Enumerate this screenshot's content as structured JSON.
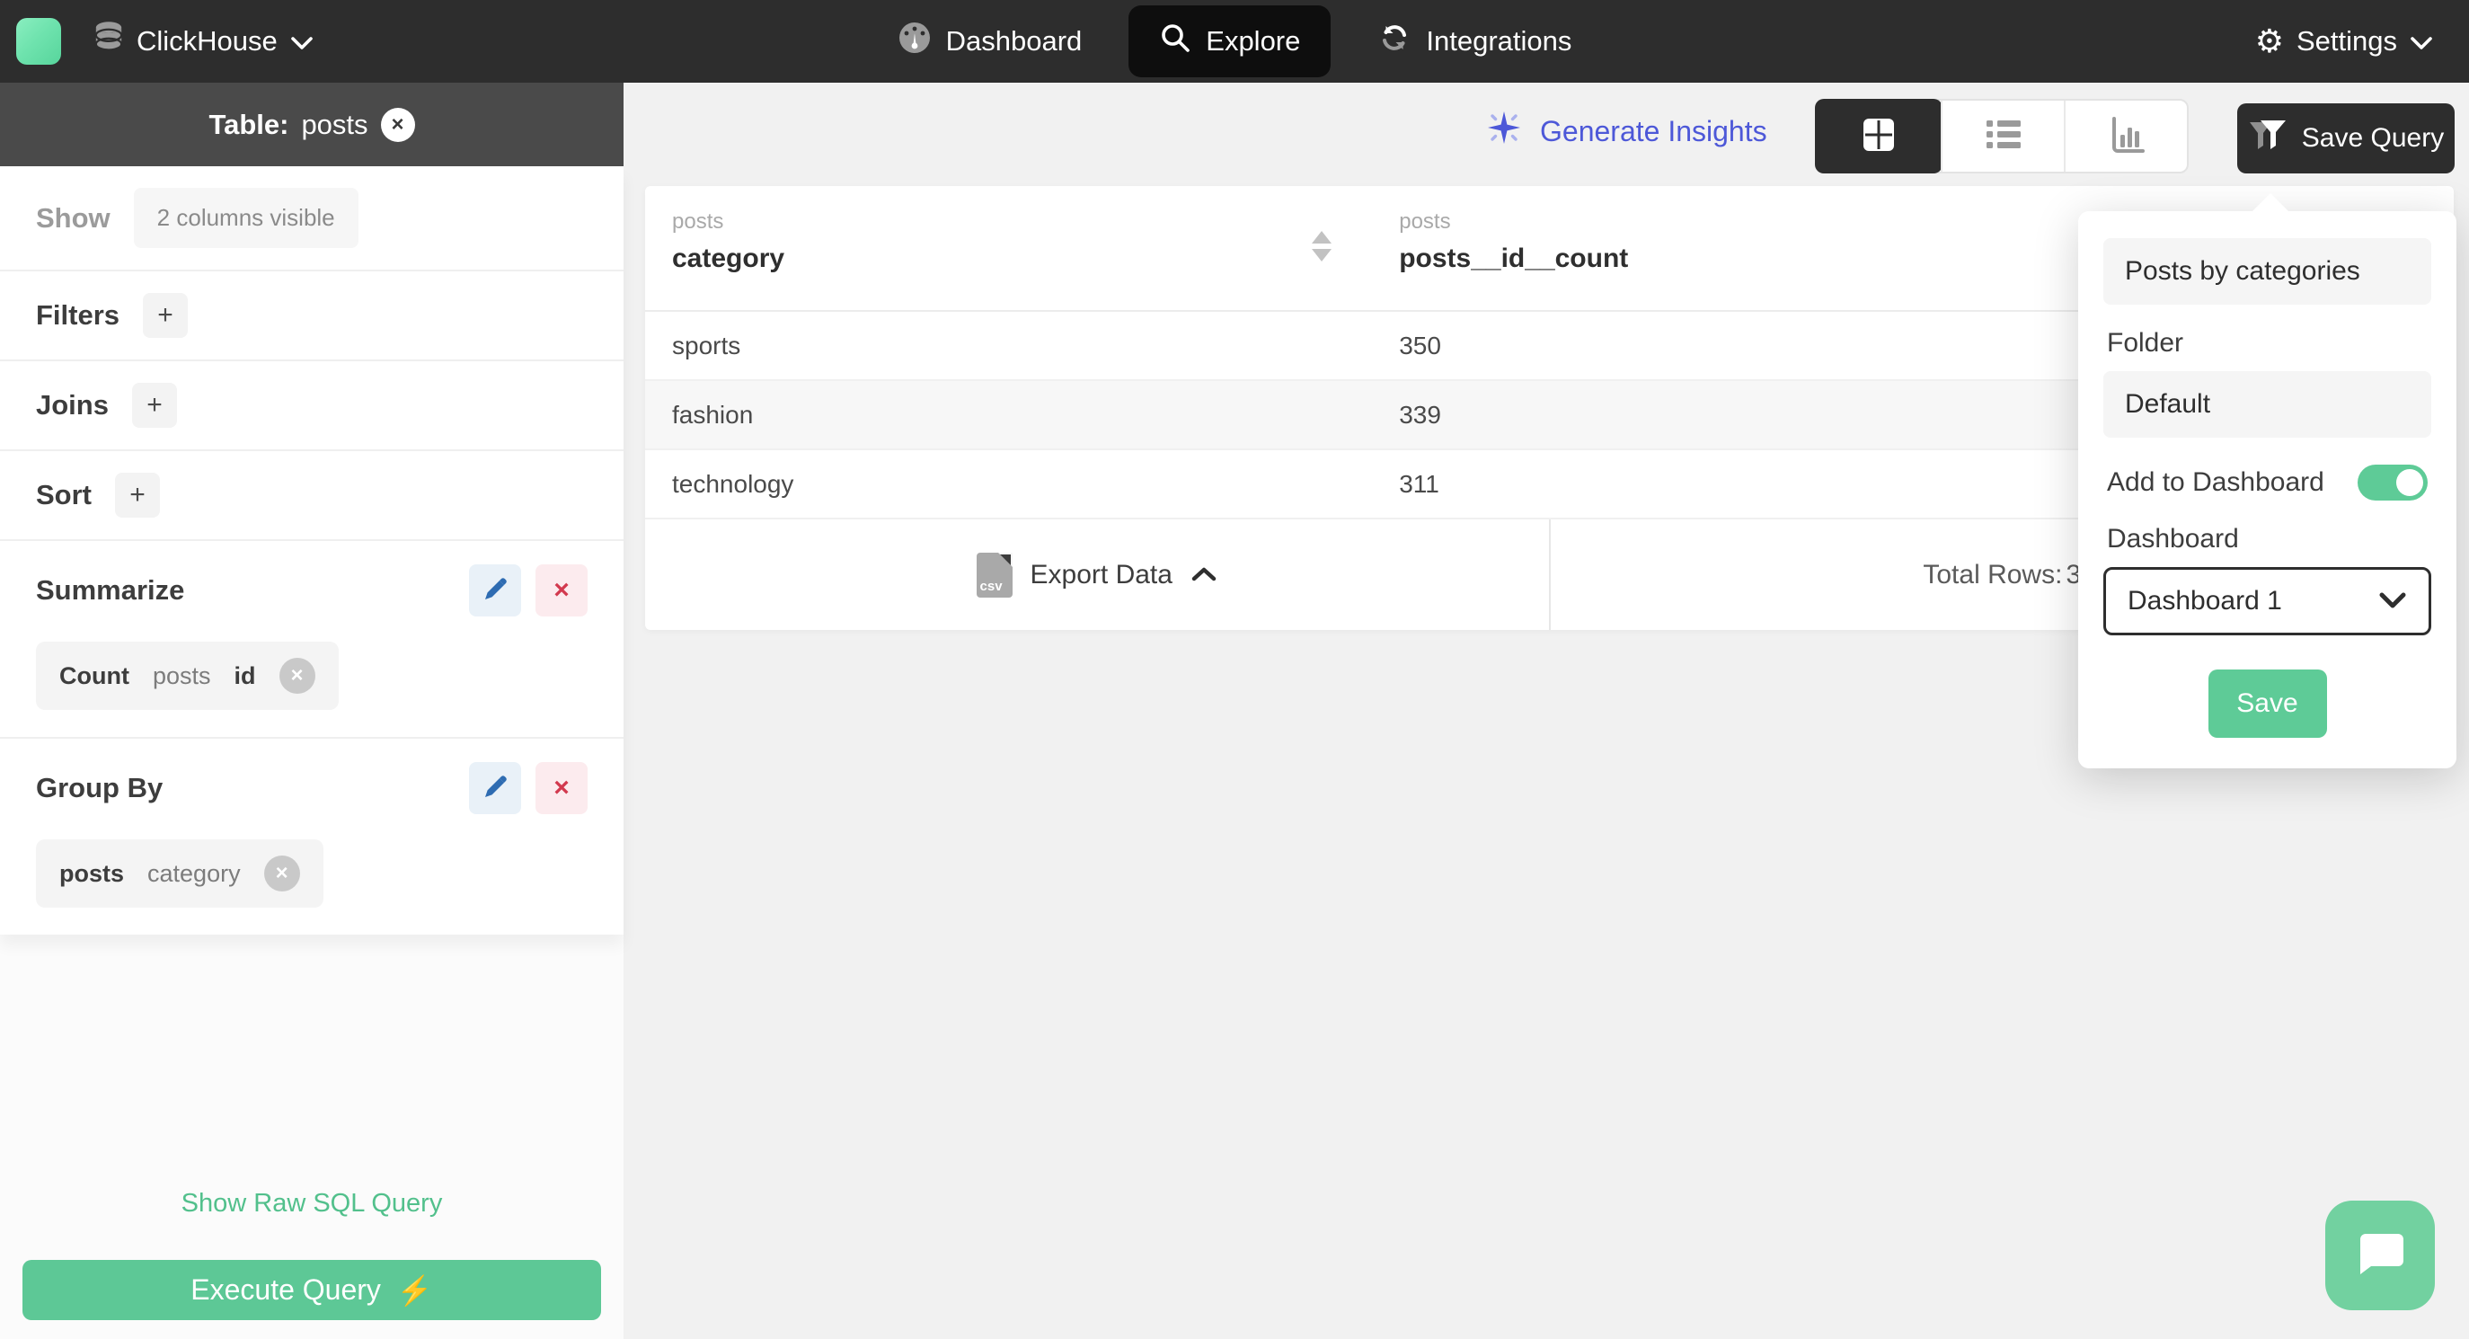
{
  "topbar": {
    "app_name": "ClickHouse",
    "nav": [
      {
        "label": "Dashboard",
        "icon": "gauge-icon",
        "active": false
      },
      {
        "label": "Explore",
        "icon": "search-icon",
        "active": true
      },
      {
        "label": "Integrations",
        "icon": "sync-icon",
        "active": false
      }
    ],
    "settings_label": "Settings"
  },
  "sidebar": {
    "table_label": "Table:",
    "table_name": "posts",
    "show_label": "Show",
    "show_value": "2 columns visible",
    "filters_label": "Filters",
    "joins_label": "Joins",
    "sort_label": "Sort",
    "add_action": "+",
    "summarize": {
      "label": "Summarize",
      "chip": {
        "agg": "Count",
        "table": "posts",
        "column": "id"
      }
    },
    "group_by": {
      "label": "Group By",
      "chip": {
        "table": "posts",
        "column": "category"
      }
    },
    "raw_sql_link": "Show Raw SQL Query",
    "execute_button": "Execute Query"
  },
  "toolbar": {
    "generate_insights_label": "Generate Insights",
    "save_query_label": "Save Query",
    "view_modes": [
      "table",
      "list",
      "chart"
    ],
    "active_view": "table"
  },
  "results": {
    "columns": [
      {
        "group": "posts",
        "name": "category",
        "sortable": true
      },
      {
        "group": "posts",
        "name": "posts__id__count",
        "sortable": false
      }
    ],
    "rows": [
      [
        "sports",
        "350"
      ],
      [
        "fashion",
        "339"
      ],
      [
        "technology",
        "311"
      ]
    ],
    "export_label": "Export Data",
    "total_rows_label": "Total Rows:",
    "total_rows": "3"
  },
  "save_popover": {
    "name_value": "Posts by categories",
    "folder_label": "Folder",
    "folder_value": "Default",
    "add_to_dashboard_label": "Add to Dashboard",
    "toggle_on": true,
    "dashboard_label": "Dashboard",
    "dashboard_value": "Dashboard 1",
    "save_label": "Save"
  },
  "colors": {
    "topbar_bg": "#2d2d2d",
    "active_pill_bg": "#0e0e0e",
    "sidebar_header_bg": "#4a4a4a",
    "primary_green": "#5dc896",
    "toggle_green": "#5ecb97",
    "insights_indigo": "#4d58d8",
    "edit_blue": "#2e6cb2",
    "remove_red": "#d2394e",
    "row_alt_bg": "#f7f7f7",
    "page_bg": "#f1f1f1"
  }
}
